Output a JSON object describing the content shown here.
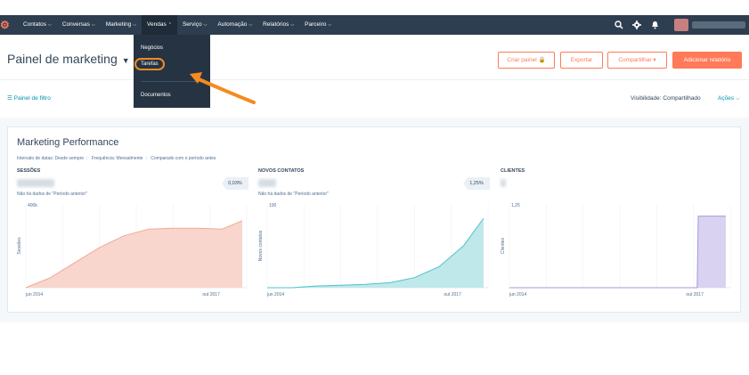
{
  "nav": {
    "items": [
      "Contatos",
      "Conversas",
      "Marketing",
      "Vendas",
      "Serviço",
      "Automação",
      "Relatórios",
      "Parceiro"
    ]
  },
  "dropdown": {
    "items": [
      "Negócios",
      "Tarefas",
      "Documentos"
    ]
  },
  "header": {
    "title": "Painel de marketing",
    "buttons": {
      "criar": "Criar painel",
      "exportar": "Exportar",
      "compartilhar": "Compartilhar",
      "adicionar": "Adicionar relatório"
    }
  },
  "filter_bar": {
    "filter_label": "Painel de filtro",
    "visibility_label": "Visibilidade:",
    "visibility_value": "Compartilhado",
    "actions_label": "Ações"
  },
  "card": {
    "title": "Marketing Performance",
    "meta": [
      "Intervalo de datas: Desde sempre",
      "Frequência: Mensalmente",
      "Comparado com o período antes"
    ]
  },
  "colors": {
    "nav_bg": "#2d3e50",
    "accent": "#ff7a59",
    "link": "#0091ae",
    "sessions_fill": "#f8d6cd",
    "sessions_line": "#f2a896",
    "contacts_fill": "#bfe8ea",
    "contacts_line": "#4cc3cb",
    "customers_fill": "#d9d2f0",
    "customers_line": "#a997dc",
    "highlight": "#f58a1f"
  },
  "icons": [
    "hubspot-sprocket-icon",
    "search-icon",
    "gear-icon",
    "bell-icon",
    "lock-icon",
    "filter-icon"
  ],
  "chart_data": [
    {
      "type": "area",
      "title": "SESSÕES",
      "change": "0,03%",
      "note": "Não há dados de \"Período anterior\"",
      "ylabel": "Sessões",
      "y_tick_labels": [
        "400k"
      ],
      "x_tick_labels": [
        "jun 2014",
        "out 2017"
      ],
      "series": [
        {
          "x": [
            "jun 2014",
            "jan 2015",
            "jul 2015",
            "jan 2016",
            "jul 2016",
            "jan 2017",
            "jul 2017",
            "out 2017",
            "jan 2018",
            "mai 2018"
          ],
          "values": [
            0.0,
            0.12,
            0.3,
            0.48,
            0.62,
            0.7,
            0.71,
            0.71,
            0.7,
            0.8
          ]
        }
      ]
    },
    {
      "type": "area",
      "title": "NOVOS CONTATOS",
      "change": "1,25%",
      "note": "Não há dados de \"Período anterior\"",
      "ylabel": "Novos contatos",
      "y_tick_labels": [
        "100"
      ],
      "x_tick_labels": [
        "jun 2014",
        "out 2017"
      ],
      "series": [
        {
          "x": [
            "jun 2014",
            "jan 2015",
            "jan 2016",
            "jan 2017",
            "jul 2017",
            "out 2017",
            "dez 2017",
            "fev 2018",
            "abr 2018",
            "mai 2018"
          ],
          "values": [
            0.0,
            0.0,
            0.02,
            0.03,
            0.04,
            0.06,
            0.12,
            0.25,
            0.5,
            0.83
          ]
        }
      ]
    },
    {
      "type": "area",
      "title": "CLIENTES",
      "ylabel": "Clientes",
      "y_tick_labels": [
        "1,25"
      ],
      "x_tick_labels": [
        "jun 2014",
        "out 2017"
      ],
      "series": [
        {
          "x": [
            "jun 2014",
            "jan 2016",
            "jul 2017",
            "jan 2018",
            "fev 2018",
            "mai 2018"
          ],
          "values": [
            0.0,
            0.0,
            0.0,
            0.0,
            0.9,
            0.9
          ]
        }
      ]
    }
  ]
}
